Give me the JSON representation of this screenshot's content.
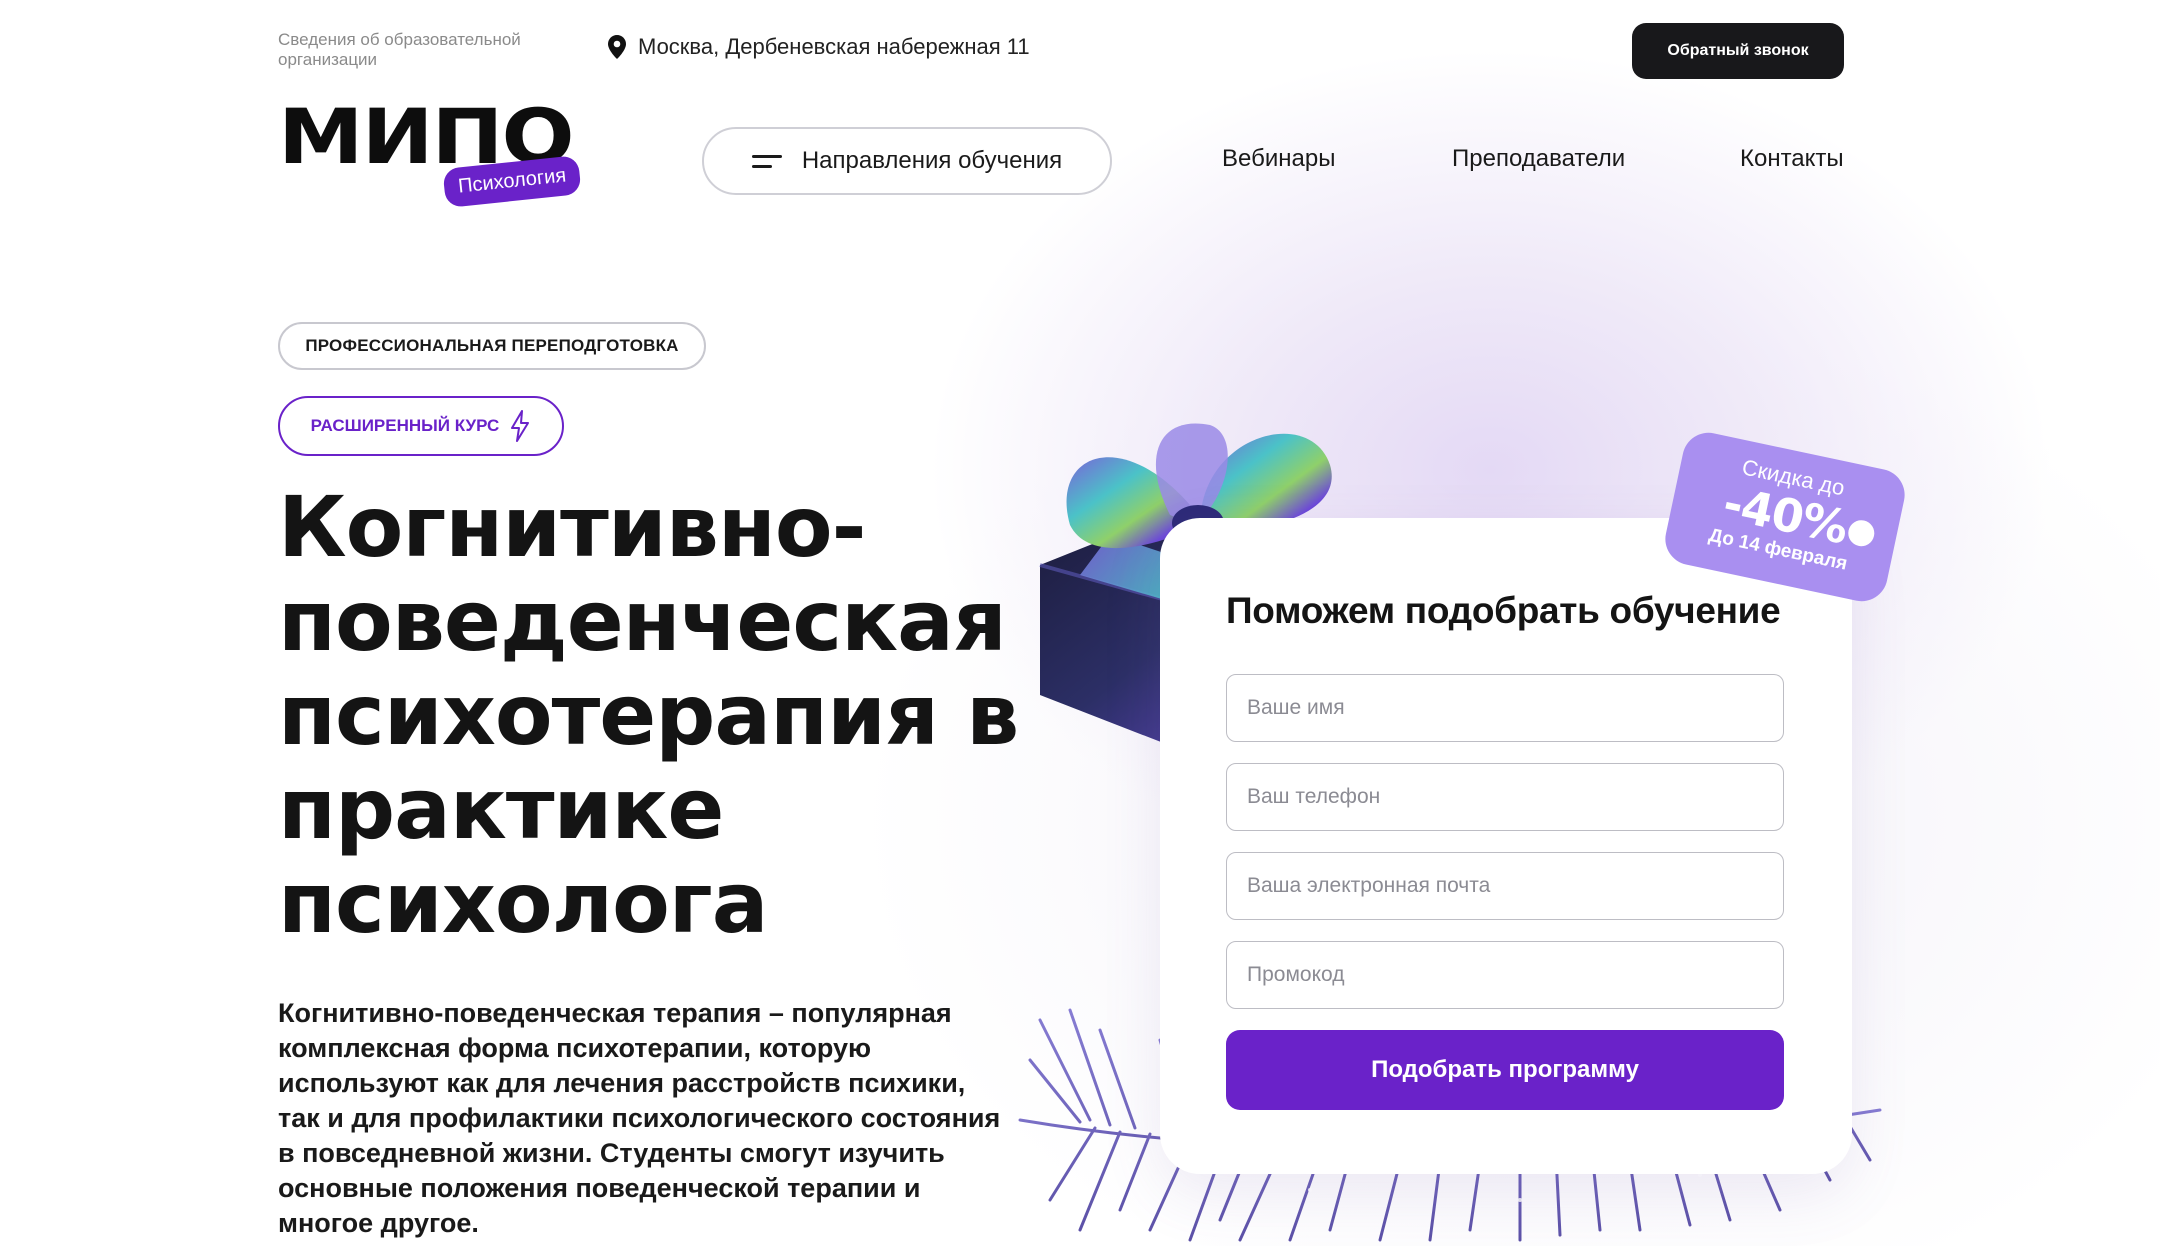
{
  "header": {
    "org_info": "Сведения об образовательной организации",
    "address": "Москва, Дербеневская набережная 11",
    "callback_label": "Обратный звонок"
  },
  "logo": {
    "word": "МИПО",
    "badge": "Психология"
  },
  "nav": {
    "directions_label": "Направления обучения",
    "links": [
      "Вебинары",
      "Преподаватели",
      "Контакты"
    ]
  },
  "tags": {
    "program_type": "ПРОФЕССИОНАЛЬНАЯ ПЕРЕПОДГОТОВКА",
    "course_level": "РАСШИРЕННЫЙ КУРС"
  },
  "hero": {
    "title": "Когнитивно-поведенческая психотерапия в практике психолога",
    "description": "Когнитивно-поведенческая терапия – популярная комплексная форма психотерапии, которую используют как для лечения расстройств психики, так и для профилактики психологического состояния в повседневной жизни. Студенты смогут изучить основные положения поведенческой терапии и многое другое."
  },
  "form": {
    "title": "Поможем подобрать обучение",
    "name_placeholder": "Ваше имя",
    "phone_placeholder": "Ваш телефон",
    "email_placeholder": "Ваша электронная почта",
    "promo_placeholder": "Промокод",
    "submit_label": "Подобрать программу"
  },
  "discount": {
    "line1": "Скидка до",
    "value": "-40%",
    "until": "До 14 февраля"
  },
  "colors": {
    "brand": "#6a22c9",
    "dark_button": "#18181b",
    "discount_bg": "#a98ff0"
  }
}
